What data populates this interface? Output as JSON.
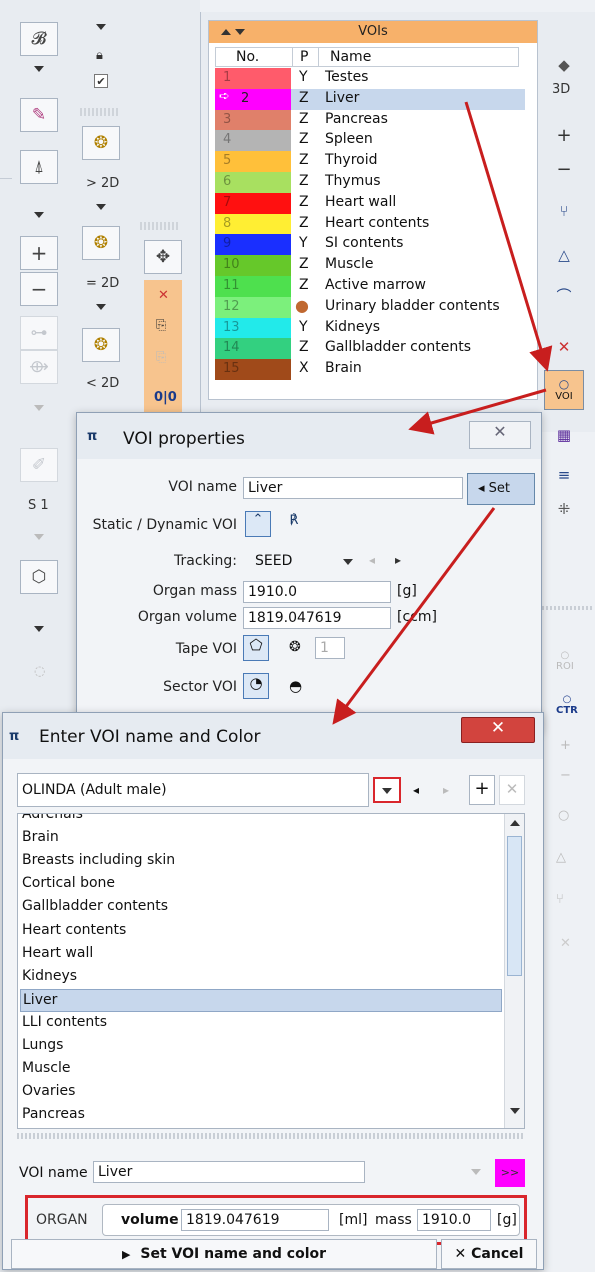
{
  "toolbar_left": {
    "labels": {
      "gt2d": "> 2D",
      "eq2d": "= 2D",
      "lt2d": "< 2D",
      "s1": "S 1"
    }
  },
  "voi_table": {
    "title": "VOIs",
    "columns": [
      "No.",
      "P",
      "Name"
    ],
    "rows": [
      {
        "no": "1",
        "p": "Y",
        "name": "Testes",
        "color": "#ff5b6b"
      },
      {
        "no": "2",
        "p": "Z",
        "name": "Liver",
        "color": "#ff00ff"
      },
      {
        "no": "3",
        "p": "Z",
        "name": "Pancreas",
        "color": "#e0806a"
      },
      {
        "no": "4",
        "p": "Z",
        "name": "Spleen",
        "color": "#b4b4b4"
      },
      {
        "no": "5",
        "p": "Z",
        "name": "Thyroid",
        "color": "#ffc03a"
      },
      {
        "no": "6",
        "p": "Z",
        "name": "Thymus",
        "color": "#a8e060"
      },
      {
        "no": "7",
        "p": "Z",
        "name": "Heart wall",
        "color": "#ff1010"
      },
      {
        "no": "8",
        "p": "Z",
        "name": "Heart contents",
        "color": "#ffee33"
      },
      {
        "no": "9",
        "p": "Y",
        "name": "SI contents",
        "color": "#1a2fff"
      },
      {
        "no": "10",
        "p": "Z",
        "name": "Muscle",
        "color": "#66c82a"
      },
      {
        "no": "11",
        "p": "Z",
        "name": "Active marrow",
        "color": "#4ee04e"
      },
      {
        "no": "12",
        "p": "",
        "name": "Urinary bladder contents",
        "color": "#7cf07c"
      },
      {
        "no": "13",
        "p": "Y",
        "name": "Kidneys",
        "color": "#22eaea"
      },
      {
        "no": "14",
        "p": "Z",
        "name": "Gallbladder contents",
        "color": "#33d080"
      },
      {
        "no": "15",
        "p": "X",
        "name": "Brain",
        "color": "#a04a1a"
      }
    ]
  },
  "right_toolbar": {
    "label_3d": "3D",
    "voi": "VOI",
    "roi": "ROI",
    "ctr": "CTR"
  },
  "voi_properties": {
    "title": "VOI properties",
    "voi_name_label": "VOI name",
    "voi_name_value": "Liver",
    "set_button": "Set",
    "static_dynamic_label": "Static / Dynamic VOI",
    "tracking_label": "Tracking:",
    "tracking_value": "SEED",
    "organ_mass_label": "Organ mass",
    "organ_mass_value": "1910.0",
    "organ_mass_unit": "[g]",
    "organ_volume_label": "Organ volume",
    "organ_volume_value": "1819.047619",
    "organ_volume_unit": "[ccm]",
    "tape_voi_label": "Tape VOI",
    "tape_value": "1",
    "sector_voi_label": "Sector VOI"
  },
  "enter_voi": {
    "title": "Enter VOI name and Color",
    "template": "OLINDA (Adult male)",
    "list": [
      "Adrenals",
      "Brain",
      "Breasts including skin",
      "Cortical bone",
      "Gallbladder contents",
      "Heart contents",
      "Heart wall",
      "Kidneys",
      "Liver",
      "LLI contents",
      "Lungs",
      "Muscle",
      "Ovaries",
      "Pancreas"
    ],
    "selected_index": 8,
    "voi_name_label": "VOI name",
    "voi_name_value": "Liver",
    "color_button": ">>",
    "organ_label": "ORGAN",
    "volume_label": "volume",
    "volume_value": "1819.047619",
    "volume_unit": "[ml]",
    "mass_label": "mass",
    "mass_value": "1910.0",
    "mass_unit": "[g]",
    "set_button": "Set VOI name and color",
    "cancel_button": "Cancel"
  },
  "colors": {
    "accent": "#f7b16a",
    "highlight_red": "#d9262c",
    "selection": "#c7d7ec",
    "magenta": "#ff00ff"
  }
}
